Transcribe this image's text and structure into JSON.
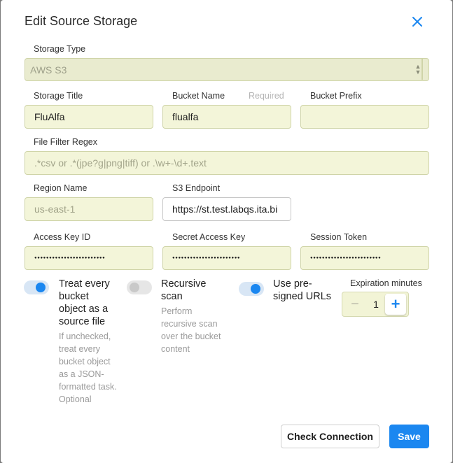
{
  "dialog": {
    "title": "Edit Source Storage"
  },
  "storage_type": {
    "label": "Storage Type",
    "value": "AWS S3"
  },
  "storage_title": {
    "label": "Storage Title",
    "value": "FluAlfa"
  },
  "bucket_name": {
    "label": "Bucket Name",
    "required_hint": "Required",
    "value": "flualfa"
  },
  "bucket_prefix": {
    "label": "Bucket Prefix",
    "value": ""
  },
  "file_filter_regex": {
    "label": "File Filter Regex",
    "placeholder": ".*csv or .*(jpe?g|png|tiff) or .\\w+-\\d+.text"
  },
  "region_name": {
    "label": "Region Name",
    "placeholder": "us-east-1"
  },
  "s3_endpoint": {
    "label": "S3 Endpoint",
    "value": "https://st.test.labqs.ita.bi"
  },
  "access_key_id": {
    "label": "Access Key ID",
    "value": "●●●●●●●●●●●●●●●●●●●●●●●●"
  },
  "secret_access_key": {
    "label": "Secret Access Key",
    "value": "●●●●●●●●●●●●●●●●●●●●●●●"
  },
  "session_token": {
    "label": "Session Token",
    "value": "●●●●●●●●●●●●●●●●●●●●●●●●"
  },
  "options": {
    "treat_as_source": {
      "title_lines": [
        "Treat every",
        "bucket",
        "object as a",
        "source file"
      ],
      "desc_lines": [
        "If unchecked,",
        "treat every",
        "bucket object",
        "as a JSON-",
        "formatted task.",
        "Optional"
      ],
      "enabled": true
    },
    "recursive_scan": {
      "title_lines": [
        "Recursive",
        "scan"
      ],
      "desc_lines": [
        "Perform",
        "recursive scan",
        "over the bucket",
        "content"
      ],
      "enabled": false
    },
    "presigned_urls": {
      "title_lines": [
        "Use pre-",
        "signed URLs"
      ],
      "enabled": true
    }
  },
  "expiration": {
    "label": "Expiration minutes",
    "value": "1",
    "minus_symbol": "−",
    "plus_symbol": "+"
  },
  "buttons": {
    "check_connection": "Check Connection",
    "save": "Save"
  },
  "colors": {
    "accent": "#1b87f0",
    "field_bg": "#f3f5d9"
  }
}
